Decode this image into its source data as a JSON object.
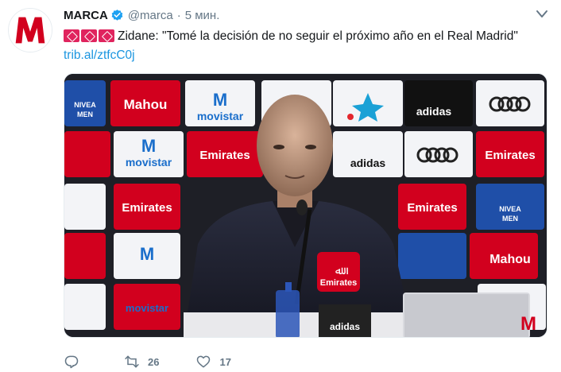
{
  "tweet": {
    "author_name": "MARCA",
    "handle": "@marca",
    "separator": "·",
    "time": "5 мин.",
    "text_main": "Zidane: \"Tomé la decisión de no seguir el próximo año en el Real Madrid\"",
    "link": "trib.al/ztfcC0j",
    "flag_count": 3
  },
  "avatar": {
    "letter": "M"
  },
  "media": {
    "sponsor_boards": [
      "NIVEA MEN",
      "Mahou",
      "movistar",
      "Emirates",
      "adidas"
    ],
    "podium_label": "Emirates",
    "watermark": "M"
  },
  "actions": {
    "reply_count": "",
    "retweet_count": "26",
    "like_count": "17"
  },
  "colors": {
    "accent": "#1b95e0",
    "brand_red": "#d2001e",
    "muted": "#657786"
  }
}
